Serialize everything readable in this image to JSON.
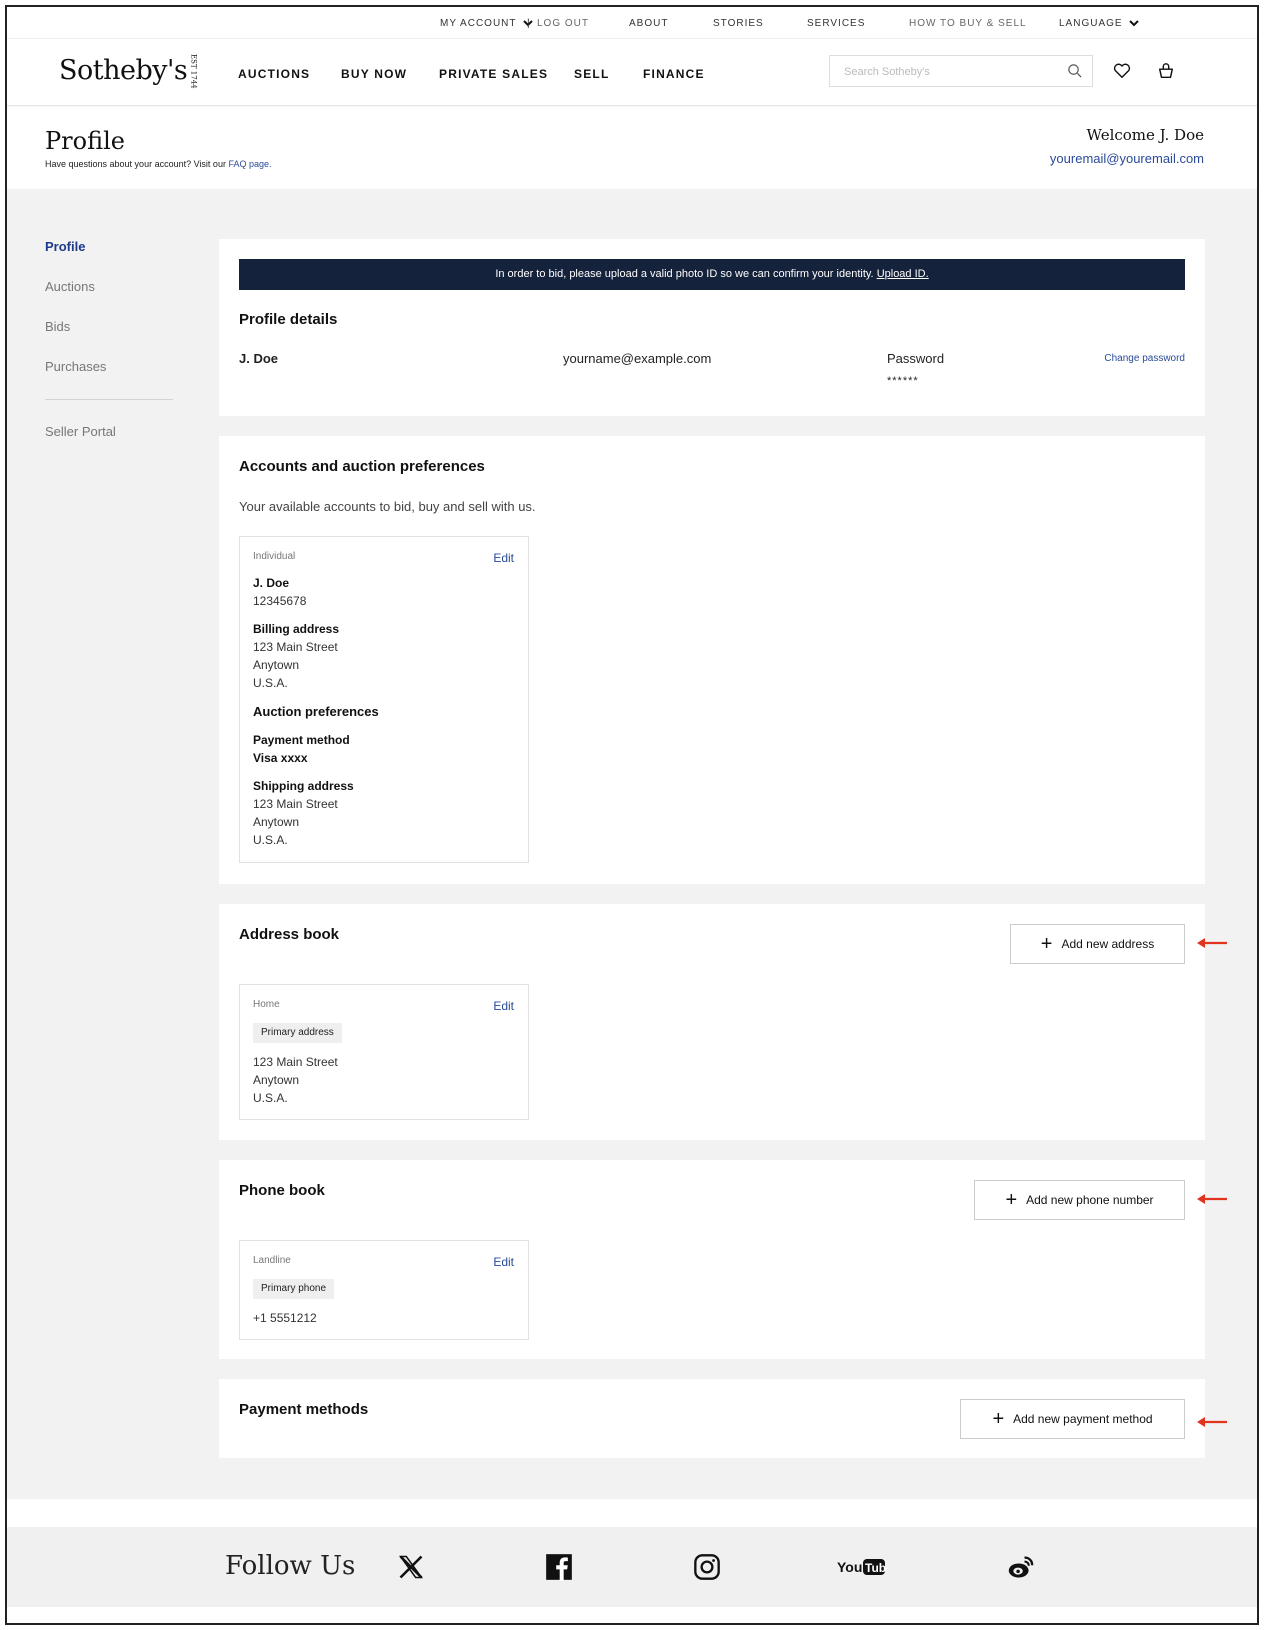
{
  "utility_nav": {
    "my_account": "MY ACCOUNT",
    "log_out": "LOG OUT",
    "about": "ABOUT",
    "stories": "STORIES",
    "services": "SERVICES",
    "how_to": "HOW TO BUY & SELL",
    "language": "LANGUAGE"
  },
  "header": {
    "logo": "Sotheby's",
    "logo_est": "EST 1744",
    "nav": [
      "AUCTIONS",
      "BUY NOW",
      "PRIVATE SALES",
      "SELL",
      "FINANCE"
    ],
    "search_placeholder": "Search Sotheby's"
  },
  "profile_header": {
    "title": "Profile",
    "subtitle": "Have questions about your account? Visit our",
    "faq_link": "FAQ page.",
    "welcome": "Welcome J. Doe",
    "email": "youremail@youremail.com"
  },
  "sidebar": {
    "items": [
      "Profile",
      "Auctions",
      "Bids",
      "Purchases"
    ],
    "seller_portal": "Seller Portal"
  },
  "banner": {
    "text": "In order to bid, please upload a valid photo ID so we can confirm your identity.",
    "link": "Upload ID."
  },
  "profile_details": {
    "heading": "Profile details",
    "name": "J. Doe",
    "email": "yourname@example.com",
    "password_label": "Password",
    "password_value": "******",
    "change_password": "Change password"
  },
  "accounts": {
    "heading": "Accounts and auction preferences",
    "description": "Your available accounts to bid, buy and sell with us.",
    "card": {
      "type": "Individual",
      "edit": "Edit",
      "name": "J. Doe",
      "number": "12345678",
      "billing_label": "Billing address",
      "billing_lines": [
        "123 Main Street",
        "Anytown",
        "U.S.A."
      ],
      "prefs_heading": "Auction preferences",
      "payment_label": "Payment method",
      "payment_value": "Visa xxxx",
      "shipping_label": "Shipping address",
      "shipping_lines": [
        "123 Main Street",
        "Anytown",
        "U.S.A."
      ]
    }
  },
  "address_book": {
    "heading": "Address book",
    "add_button": "Add new address",
    "card": {
      "type": "Home",
      "edit": "Edit",
      "tag": "Primary address",
      "lines": [
        "123 Main Street",
        "Anytown",
        "U.S.A."
      ]
    }
  },
  "phone_book": {
    "heading": "Phone book",
    "add_button": "Add new phone number",
    "card": {
      "type": "Landline",
      "edit": "Edit",
      "tag": "Primary phone",
      "number": "+1 5551212"
    }
  },
  "payment_methods": {
    "heading": "Payment methods",
    "add_button": "Add new payment method"
  },
  "footer": {
    "follow": "Follow Us",
    "socials": [
      "x-icon",
      "facebook-icon",
      "instagram-icon",
      "youtube-icon",
      "weibo-icon"
    ]
  },
  "colors": {
    "accent_link": "#2a4a9a",
    "banner_bg": "#14223b",
    "annotation_arrow": "#e0341e"
  }
}
